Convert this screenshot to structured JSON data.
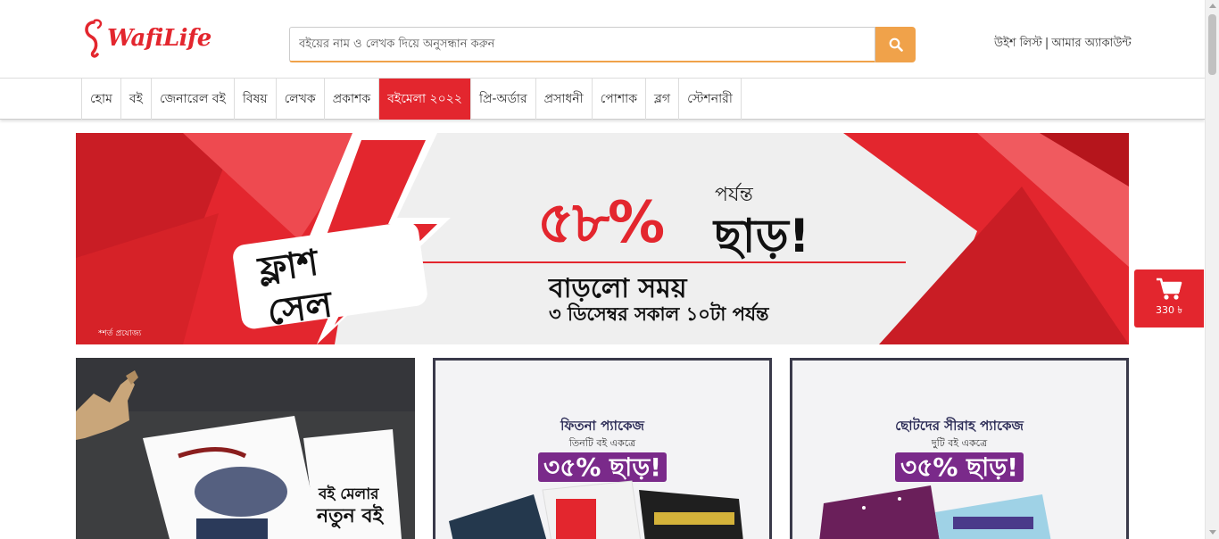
{
  "header": {
    "logo_text": "WafiLife",
    "search_placeholder": "বইয়ের নাম ও লেখক দিয়ে অনুসন্ধান করুন",
    "wishlist_label": "উইশ লিস্ট",
    "separator": "|",
    "account_label": "আমার অ্যাকাউন্ট"
  },
  "nav": {
    "items": [
      {
        "label": "হোম"
      },
      {
        "label": "বই"
      },
      {
        "label": "জেনারেল বই"
      },
      {
        "label": "বিষয়"
      },
      {
        "label": "লেখক"
      },
      {
        "label": "প্রকাশক"
      },
      {
        "label": "বইমেলা ২০২২"
      },
      {
        "label": "প্রি-অর্ডার"
      },
      {
        "label": "প্রসাধনী"
      },
      {
        "label": "পোশাক"
      },
      {
        "label": "ব্লগ"
      },
      {
        "label": "স্টেশনারী"
      }
    ],
    "active_index": 6
  },
  "banner": {
    "discount": "৫৮%",
    "upto": "পর্যন্ত",
    "off": "ছাড়!",
    "extended": "বাড়লো সময়",
    "until": "৩ ডিসেম্বর সকাল ১০টা পর্যন্ত",
    "flash_line1": "ফ্লাশ",
    "flash_line2": "সেল",
    "terms": "*শর্ত প্রযোজ্য"
  },
  "cards": {
    "card1": {
      "tag_line1": "বই মেলার",
      "tag_line2": "নতুন বই"
    },
    "card2": {
      "title": "ফিতনা প্যাকেজ",
      "subtitle": "তিনটি বই একত্রে",
      "offer": "৩৫% ছাড়!"
    },
    "card3": {
      "title": "ছোটদের সীরাহ প্যাকেজ",
      "subtitle": "দুটি বই একত্রে",
      "offer": "৩৫% ছাড়!"
    }
  },
  "cart": {
    "amount": "330 ৳"
  },
  "colors": {
    "brand_red": "#e3262e",
    "search_orange": "#f0a24a",
    "offer_purple": "#7a2a8a"
  },
  "icons": [
    "search-icon",
    "cart-icon",
    "logo-icon"
  ]
}
